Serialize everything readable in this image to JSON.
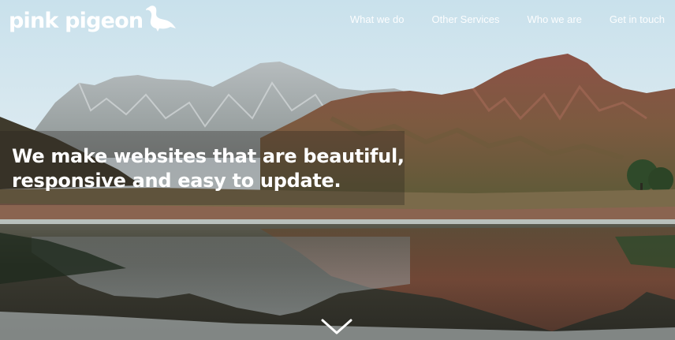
{
  "brand": {
    "name": "pink pigeon",
    "logo_icon": "pigeon-icon"
  },
  "nav": {
    "items": [
      {
        "label": "What we do"
      },
      {
        "label": "Other Services"
      },
      {
        "label": "Who we are"
      },
      {
        "label": "Get in touch"
      }
    ]
  },
  "hero": {
    "headline_line1": "We make websites that are beautiful,",
    "headline_line2": "responsive and easy to update.",
    "scroll_icon": "chevron-down-icon",
    "background_description_colors": {
      "sky": "#d8e8ef",
      "mountain_red": "#8a4a3a",
      "water": "#3a3a34"
    }
  }
}
